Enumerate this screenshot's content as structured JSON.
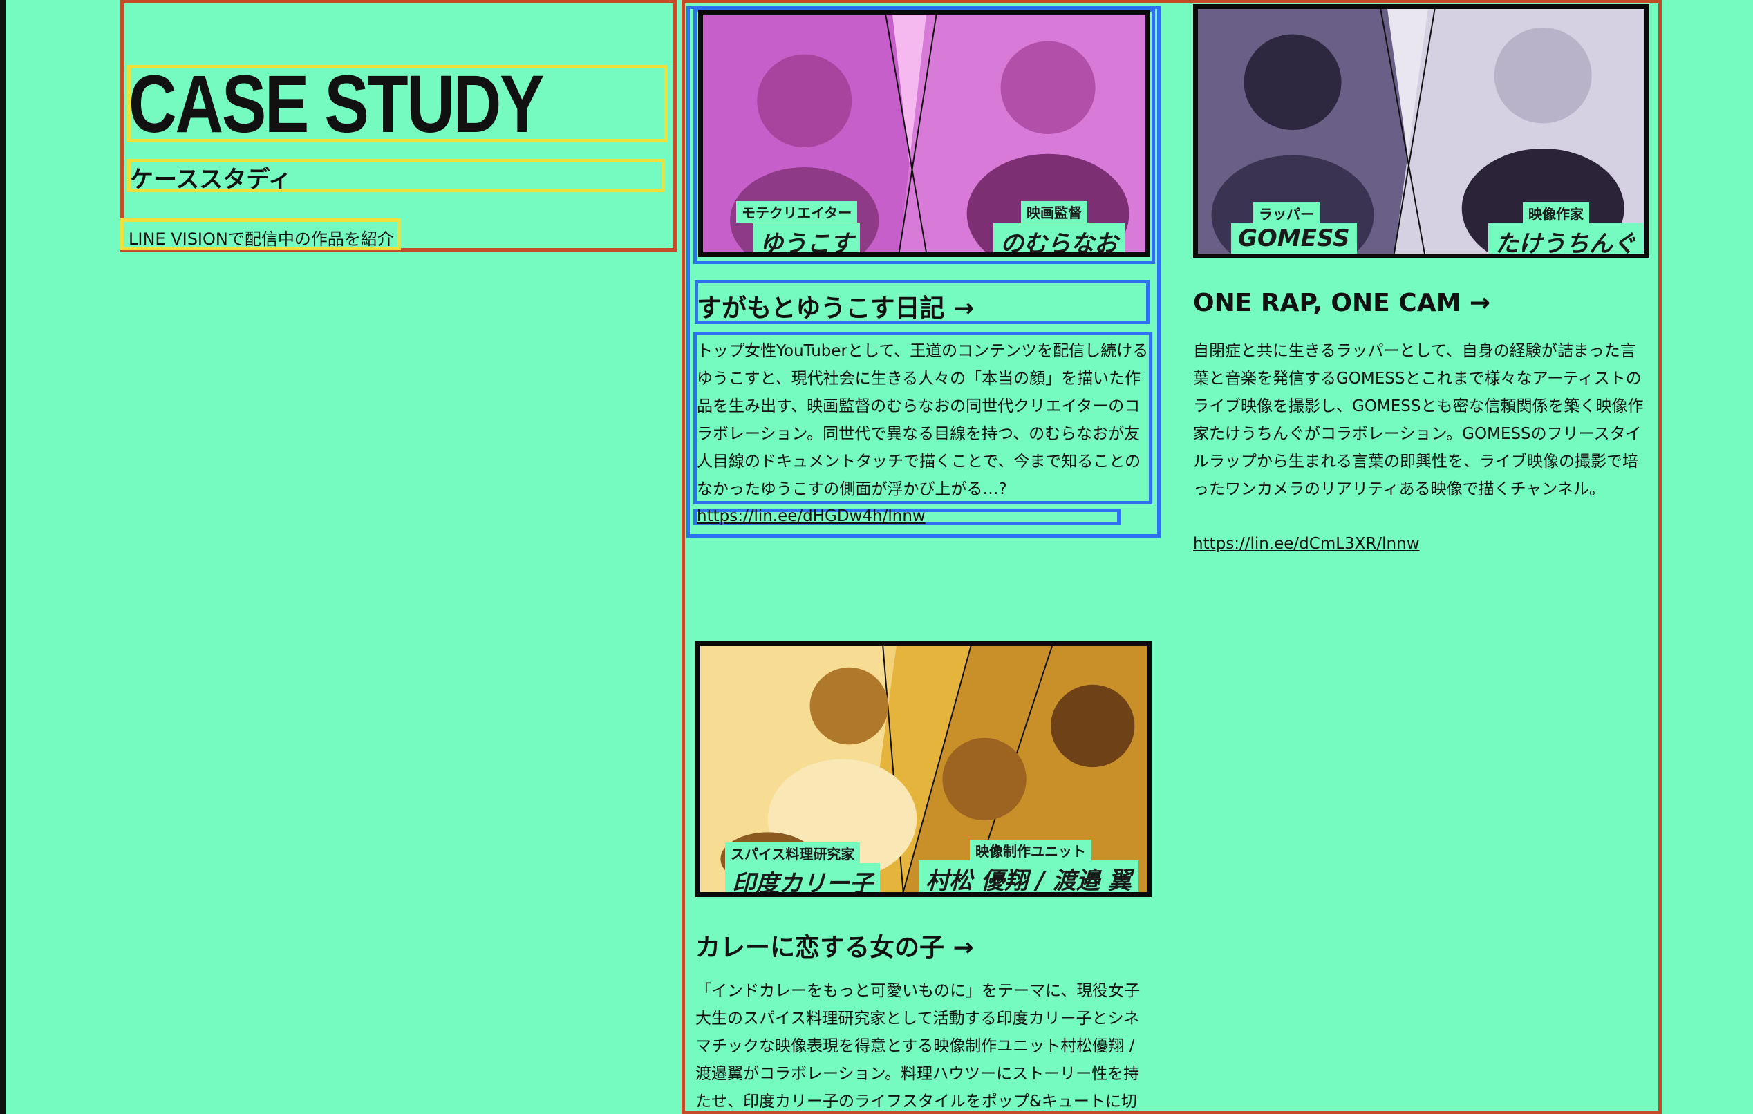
{
  "section": {
    "heading": "CASE STUDY",
    "subheading": "ケーススタディ",
    "intro": "LINE VISIONで配信中の作品を紹介"
  },
  "cards": [
    {
      "title": "すがもとゆうこす日記 →",
      "description": "トップ女性YouTuberとして、王道のコンテンツを配信し続けるゆうこすと、現代社会に生きる人々の「本当の顔」を描いた作品を生み出す、映画監督のむらなおの同世代クリエイターのコラボレーション。同世代で異なる目線を持つ、のむらなおが友人目線のドキュメントタッチで描くことで、今まで知ることのなかったゆうこすの側面が浮かび上がる…?",
      "link": "https://lin.ee/dHGDw4h/lnnw",
      "people": [
        {
          "role": "モテクリエイター",
          "name": "ゆうこす"
        },
        {
          "role": "映画監督",
          "name": "のむらなお"
        }
      ],
      "tint": "#d35fd6"
    },
    {
      "title": "ONE RAP, ONE CAM →",
      "description": "自閉症と共に生きるラッパーとして、自身の経験が詰まった言葉と音楽を発信するGOMESSとこれまで様々なアーティストのライブ映像を撮影し、GOMESSとも密な信頼関係を築く映像作家たけうちんぐがコラボレーション。GOMESSのフリースタイルラップから生まれる言葉の即興性を、ライブ映像の撮影で培ったワンカメラのリアリティある映像で描くチャンネル。",
      "link": "https://lin.ee/dCmL3XR/lnnw",
      "people": [
        {
          "role": "ラッパー",
          "name": "GOMESS"
        },
        {
          "role": "映像作家",
          "name": "たけうちんぐ"
        }
      ],
      "tint": "#6a5f86"
    },
    {
      "title": "カレーに恋する女の子 →",
      "description": "「インドカレーをもっと可愛いものに」をテーマに、現役女子大生のスパイス料理研究家として活動する印度カリー子とシネマチックな映像表現を得意とする映像制作ユニット村松優翔 / 渡邉翼がコラボレーション。料理ハウツーにストーリー性を持たせ、印度カリー子のライフスタイルをポップ&キュートに切り取り、スパイス",
      "people": [
        {
          "role": "スパイス料理研究家",
          "name": "印度カリー子"
        },
        {
          "role": "映像制作ユニット",
          "name": "村松 優翔 / 渡邉 翼"
        }
      ],
      "tint": "#e5b43c"
    }
  ],
  "colors": {
    "background": "#75fbc0",
    "annotation_red": "#c64b2a",
    "annotation_yellow": "#f2e03a",
    "annotation_blue": "#2f6ff2"
  }
}
